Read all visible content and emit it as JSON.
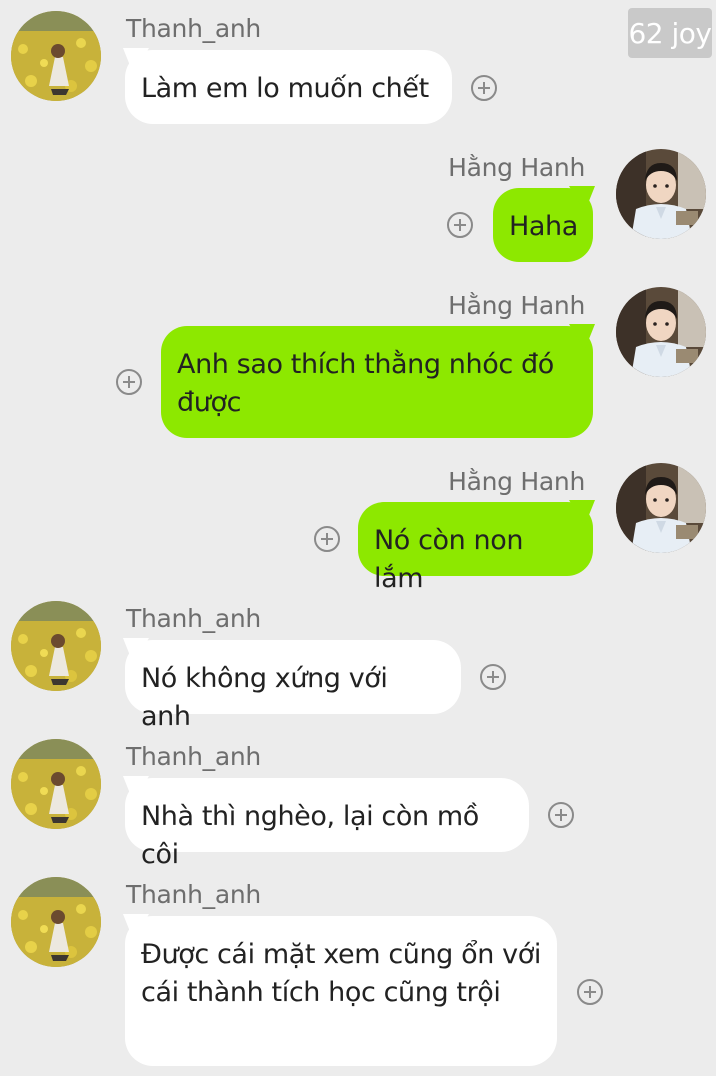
{
  "badge": "62 joy",
  "messages": [
    {
      "sender": "Thanh_anh",
      "text": "Làm em lo muốn chết"
    },
    {
      "sender": "Hằng Hanh",
      "text": "Haha"
    },
    {
      "sender": "Hằng Hanh",
      "text": "Anh sao thích thằng nhóc đó được"
    },
    {
      "sender": "Hằng Hanh",
      "text": "Nó còn non lắm"
    },
    {
      "sender": "Thanh_anh",
      "text": "Nó không xứng với anh"
    },
    {
      "sender": "Thanh_anh",
      "text": "Nhà thì nghèo, lại còn mồ côi"
    },
    {
      "sender": "Thanh_anh",
      "text": "Được cái mặt xem cũng ổn với cái thành tích học cũng trội"
    }
  ],
  "icons": {
    "add_reaction": "plus-circle-icon",
    "avatar_left": "avatar-flower-field",
    "avatar_right": "avatar-boy-portrait"
  },
  "colors": {
    "background": "#ececec",
    "outgoing_bubble": "#8de800",
    "incoming_bubble": "#ffffff"
  }
}
